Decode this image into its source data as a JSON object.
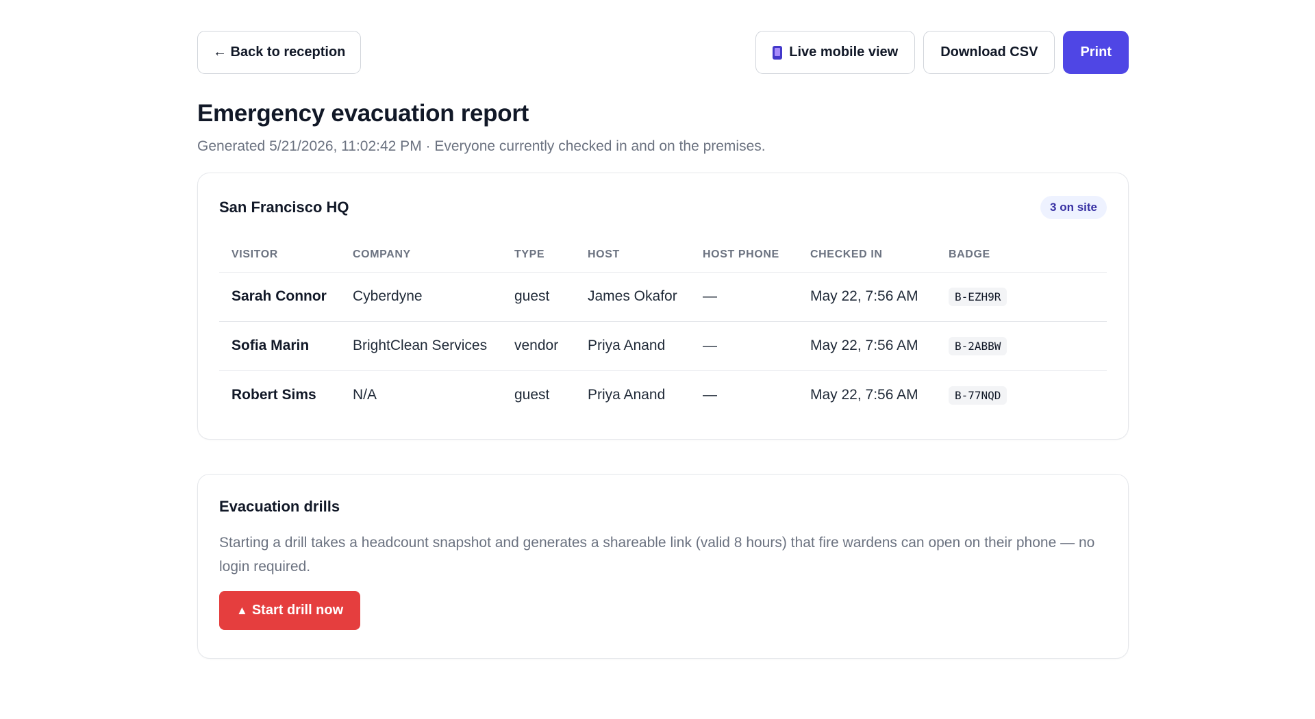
{
  "toolbar": {
    "back_label": "← Back to reception",
    "mobile_label": "Live mobile view",
    "mobile_icon": "phone-icon",
    "csv_label": "Download CSV",
    "print_label": "Print"
  },
  "page": {
    "title": "Emergency evacuation report",
    "subtitle": "Generated 5/21/2026, 11:02:42 PM · Everyone currently checked in and on the premises."
  },
  "site": {
    "name": "San Francisco HQ",
    "count_label": "3 on site",
    "columns": [
      "Visitor",
      "Company",
      "Type",
      "Host",
      "Host phone",
      "Checked in",
      "Badge"
    ],
    "rows": [
      {
        "visitor": "Sarah Connor",
        "company": "Cyberdyne",
        "type": "guest",
        "host": "James Okafor",
        "host_phone": "—",
        "checked_in": "May 22, 7:56 AM",
        "badge": "B-EZH9R"
      },
      {
        "visitor": "Sofia Marin",
        "company": "BrightClean Services",
        "type": "vendor",
        "host": "Priya Anand",
        "host_phone": "—",
        "checked_in": "May 22, 7:56 AM",
        "badge": "B-2ABBW"
      },
      {
        "visitor": "Robert Sims",
        "company": "N/A",
        "type": "guest",
        "host": "Priya Anand",
        "host_phone": "—",
        "checked_in": "May 22, 7:56 AM",
        "badge": "B-77NQD"
      }
    ]
  },
  "drills": {
    "title": "Evacuation drills",
    "description": "Starting a drill takes a headcount snapshot and generates a shareable link (valid 8 hours) that fire wardens can open on their phone — no login required.",
    "start_icon": "▲",
    "start_label": "Start drill now"
  },
  "colors": {
    "accent": "#4f46e5",
    "danger": "#e53e3e",
    "pill_bg": "#eef2ff",
    "pill_text": "#3730a3"
  }
}
